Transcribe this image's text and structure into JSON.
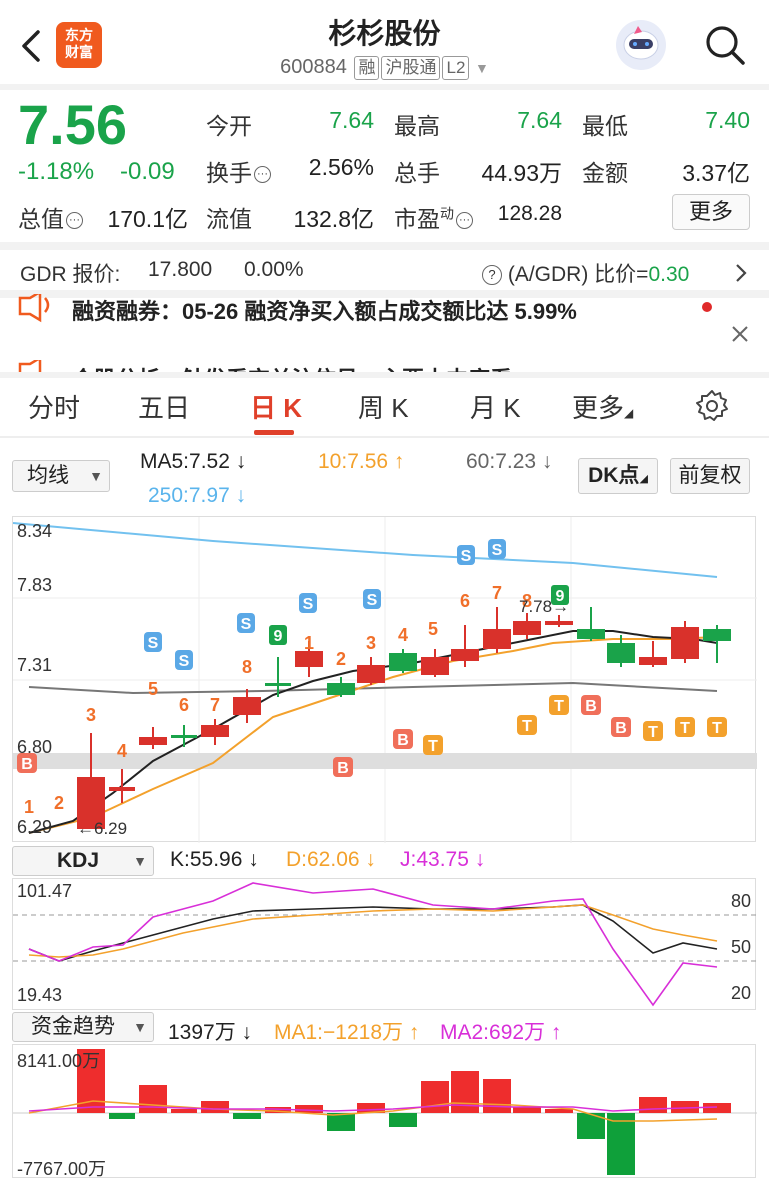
{
  "header": {
    "logo_text": "东方财富",
    "title": "杉杉股份",
    "code": "600884",
    "tags": [
      "融",
      "沪股通",
      "L2"
    ]
  },
  "quote": {
    "price": "7.56",
    "change_pct": "-1.18%",
    "change_abs": "-0.09",
    "open_label": "今开",
    "open": "7.64",
    "high_label": "最高",
    "high": "7.64",
    "low_label": "最低",
    "low": "7.40",
    "turnover_label": "换手",
    "turnover": "2.56%",
    "volume_label": "总手",
    "volume": "44.93万",
    "amount_label": "金额",
    "amount": "3.37亿",
    "mcap_label": "总值",
    "mcap": "170.1亿",
    "float_label": "流值",
    "float": "132.8亿",
    "pe_label": "市盈",
    "pe_sup": "动",
    "pe": "128.28",
    "more_label": "更多"
  },
  "gdr": {
    "label": "GDR 报价:",
    "price": "17.800",
    "pct": "0.00%",
    "ratio_label": "(A/GDR) 比价=",
    "ratio": "0.30"
  },
  "news": [
    {
      "text": "融资融券：05-26 融资净买入额占成交额比达 5.99%"
    },
    {
      "text": "个股分析：触发看空关注信号，主要由中度看"
    }
  ],
  "tabs": [
    "分时",
    "五日",
    "日 K",
    "周 K",
    "月 K",
    "更多"
  ],
  "active_tab": 2,
  "ma_panel": {
    "selector": "均线",
    "ma5": "MA5:7.52",
    "ma10": "10:7.56",
    "ma60": "60:7.23",
    "ma250": "250:7.97",
    "dk_button": "DK点",
    "adjust_button": "前复权"
  },
  "kline_axis": {
    "y_ticks": [
      "8.34",
      "7.83",
      "7.31",
      "6.80",
      "6.29"
    ],
    "min_marker": "6.29",
    "max_marker": "7.78"
  },
  "kdj": {
    "selector": "KDJ",
    "k": "K:55.96",
    "d": "D:62.06",
    "j": "J:43.75",
    "y_top": "101.47",
    "y_bottom": "19.43",
    "right_ticks": [
      "80",
      "50",
      "20"
    ]
  },
  "capital": {
    "selector": "资金趋势",
    "value": "1397万",
    "ma1": "MA1:−1218万",
    "ma2": "MA2:692万",
    "y_top": "8141.00万",
    "y_bottom": "-7767.00万"
  },
  "colors": {
    "up": "#d9312b",
    "down": "#1aa34a",
    "ma5": "#222222",
    "ma10": "#f3a12c",
    "ma60": "#777777",
    "ma250": "#72c1ef",
    "j_line": "#d82fd8"
  },
  "chart_data": {
    "type": "candlestick",
    "closes": [
      6.45,
      6.6,
      6.9,
      7.05,
      7.15,
      7.2,
      7.35,
      7.4,
      7.38,
      7.46,
      7.52,
      7.55,
      7.5,
      7.58,
      7.7,
      7.78,
      7.76,
      7.72,
      7.62,
      7.58,
      7.66,
      7.56
    ]
  }
}
